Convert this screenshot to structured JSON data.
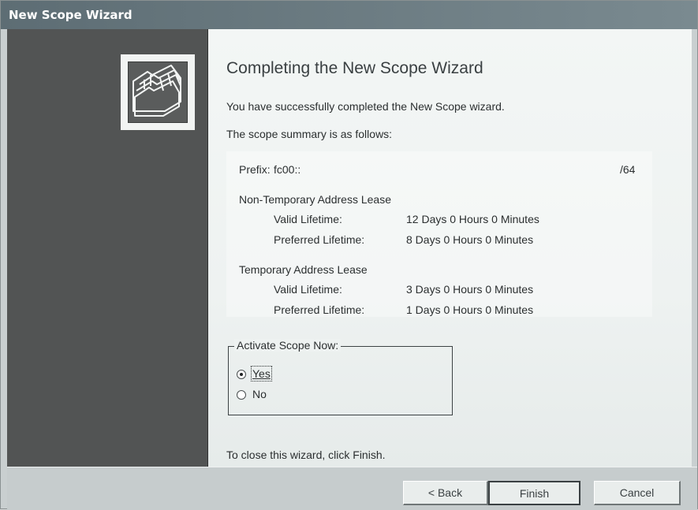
{
  "window": {
    "title": "New Scope Wizard"
  },
  "main": {
    "title": "Completing the New Scope Wizard",
    "intro": "You have successfully completed the New Scope wizard.",
    "summary_intro": "The scope summary is as follows:",
    "summary": {
      "prefix_label": "Prefix:",
      "prefix_value": "fc00::",
      "prefix_length": "/64",
      "non_temporary": {
        "header": "Non-Temporary Address Lease",
        "valid_label": "Valid Lifetime:",
        "valid_value": "12 Days 0 Hours 0 Minutes",
        "preferred_label": "Preferred Lifetime:",
        "preferred_value": "8 Days 0 Hours 0 Minutes"
      },
      "temporary": {
        "header": "Temporary Address Lease",
        "valid_label": "Valid Lifetime:",
        "valid_value": "3 Days 0 Hours 0 Minutes",
        "preferred_label": "Preferred Lifetime:",
        "preferred_value": "1 Days 0 Hours 0 Minutes"
      }
    },
    "activate": {
      "legend": "Activate Scope Now:",
      "options": [
        {
          "label": "Yes",
          "selected": true
        },
        {
          "label": "No",
          "selected": false
        }
      ]
    },
    "close_hint": "To close this wizard, click Finish."
  },
  "buttons": {
    "back": "< Back",
    "finish": "Finish",
    "cancel": "Cancel"
  },
  "icons": {
    "wizard_graphic": "folders-icon"
  },
  "colors": {
    "title_bar": "#5d6d74",
    "side_panel": "#525454",
    "content_bg": "#eef2f1"
  }
}
